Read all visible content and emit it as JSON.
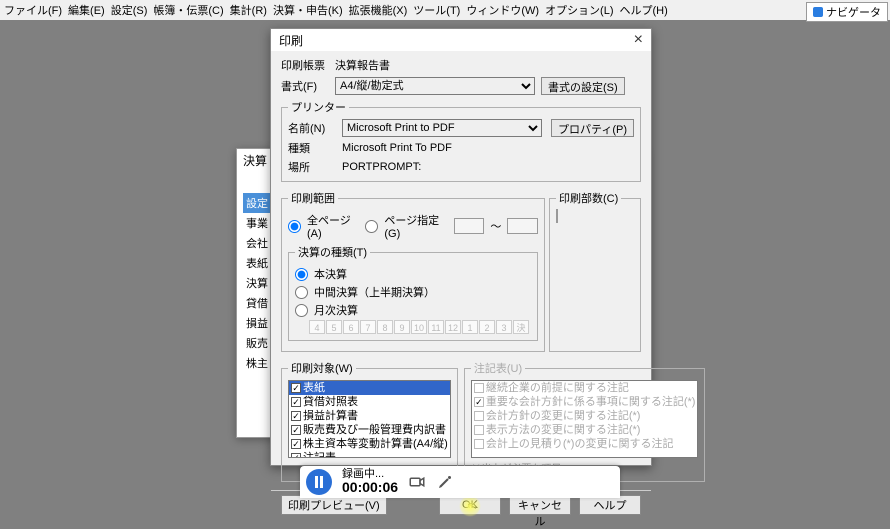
{
  "menubar": [
    "ファイル(F)",
    "編集(E)",
    "設定(S)",
    "帳簿・伝票(C)",
    "集計(R)",
    "決算・申告(K)",
    "拡張機能(X)",
    "ツール(T)",
    "ウィンドウ(W)",
    "オプション(L)",
    "ヘルプ(H)"
  ],
  "navigator": "ナビゲータ",
  "bg": {
    "title": "決算",
    "items": [
      "設定",
      "事業",
      "会社",
      "表紙",
      "決算",
      "貸借",
      "損益",
      "販売",
      "株主"
    ]
  },
  "dialog": {
    "title": "印刷",
    "form_lbl": "印刷帳票",
    "form_val": "決算報告書",
    "style_lbl": "書式(F)",
    "style_val": "A4/縦/勘定式",
    "style_btn": "書式の設定(S)",
    "printer_legend": "プリンター",
    "printer_name_lbl": "名前(N)",
    "printer_name": "Microsoft Print to PDF",
    "prop_btn": "プロパティ(P)",
    "kind_lbl": "種類",
    "kind_val": "Microsoft Print To PDF",
    "loc_lbl": "場所",
    "loc_val": "PORTPROMPT:",
    "range_legend": "印刷範囲",
    "range_all": "全ページ(A)",
    "range_pages": "ページ指定(G)",
    "copies_legend": "印刷部数(C)",
    "kessan_legend": "決算の種類(T)",
    "kessan_main": "本決算",
    "kessan_mid": "中間決算（上半期決算）",
    "kessan_month": "月次決算",
    "months": [
      "4",
      "5",
      "6",
      "7",
      "8",
      "9",
      "10",
      "11",
      "12",
      "1",
      "2",
      "3",
      "決"
    ],
    "target_legend": "印刷対象(W)",
    "targets": [
      {
        "label": "表紙",
        "sel": true,
        "chk": true
      },
      {
        "label": "貸借対照表",
        "chk": true
      },
      {
        "label": "損益計算書",
        "chk": true
      },
      {
        "label": "販売費及び一般管理費内訳書",
        "chk": true
      },
      {
        "label": "株主資本等変動計算書(A4/縦)",
        "chk": true
      },
      {
        "label": "注記表",
        "chk": true
      }
    ],
    "notes_legend": "注記表(U)",
    "notes": [
      "継続企業の前提に関する注記",
      "重要な会計方針に係る事項に関する注記(*)",
      "会計方針の変更に関する注記(*)",
      "表示方法の変更に関する注記(*)",
      "会計上の見積り(*)の変更に関する注記"
    ],
    "notes_checked_idx": 1,
    "notes_hint": "(*)出力が必要な項目",
    "preview_btn": "印刷プレビュー(V)",
    "ok": "OK",
    "cancel": "キャンセル",
    "help": "ヘルプ"
  },
  "rec": {
    "status": "録画中...",
    "time": "00:00:06"
  }
}
